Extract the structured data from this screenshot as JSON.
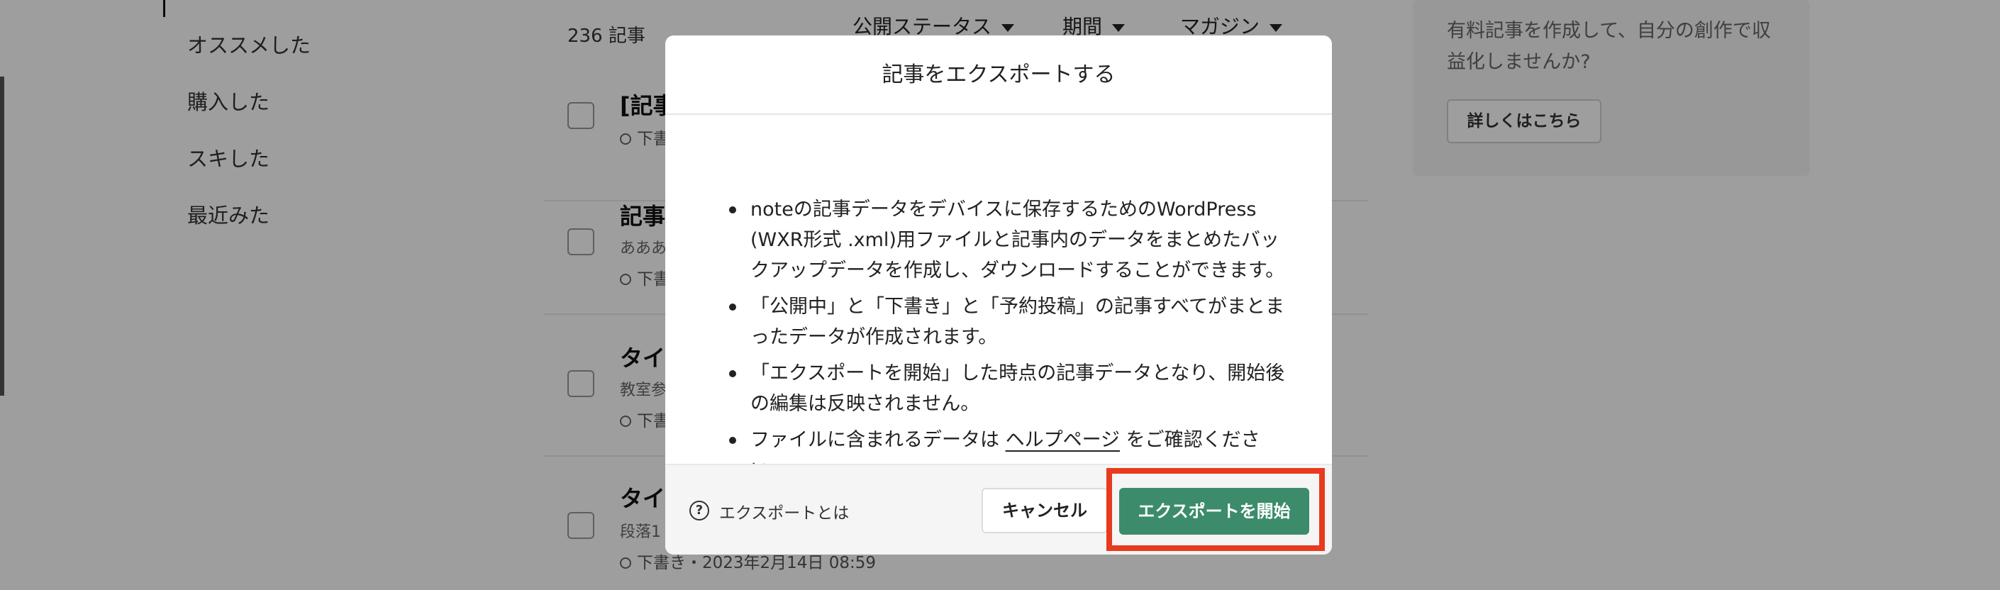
{
  "colors": {
    "accent_green": "#3c8c6c",
    "highlight_red": "#e83a1e",
    "overlay": "rgba(0,0,0,0.38)"
  },
  "sidebar": {
    "items": [
      {
        "label": "オススメした"
      },
      {
        "label": "購入した"
      },
      {
        "label": "スキした"
      },
      {
        "label": "最近みた"
      }
    ]
  },
  "main": {
    "count": "236 記事",
    "filters": [
      {
        "label": "公開ステータス"
      },
      {
        "label": "期間"
      },
      {
        "label": "マガジン"
      }
    ],
    "articles": [
      {
        "title": "[記事",
        "subtitle": "",
        "meta": "下書"
      },
      {
        "title": "記事",
        "subtitle": "あああ",
        "meta": "下書"
      },
      {
        "title": "タイ",
        "subtitle": "教室参",
        "meta": "下書"
      },
      {
        "title": "タイ",
        "subtitle": "段落1",
        "meta": "下書き・2023年2月14日 08:59"
      }
    ]
  },
  "right_card": {
    "text": "有料記事を作成して、自分の創作で収益化しませんか?",
    "button_label": "詳しくはこちら"
  },
  "modal": {
    "title": "記事をエクスポートする",
    "bullets": [
      "noteの記事データをデバイスに保存するためのWordPress (WXR形式 .xml)用ファイルと記事内のデータをまとめたバックアップデータを作成し、ダウンロードすることができます。",
      "「公開中」と「下書き」と「予約投稿」の記事すべてがまとまったデータが作成されます。",
      "「エクスポートを開始」した時点の記事データとなり、開始後の編集は反映されません。"
    ],
    "last_bullet": {
      "before": "ファイルに含まれるデータは ",
      "link": "ヘルプページ",
      "after": " をご確認ください。"
    },
    "footer": {
      "help_icon_glyph": "?",
      "help_text": "エクスポートとは",
      "cancel_label": "キャンセル",
      "start_label": "エクスポートを開始"
    }
  }
}
